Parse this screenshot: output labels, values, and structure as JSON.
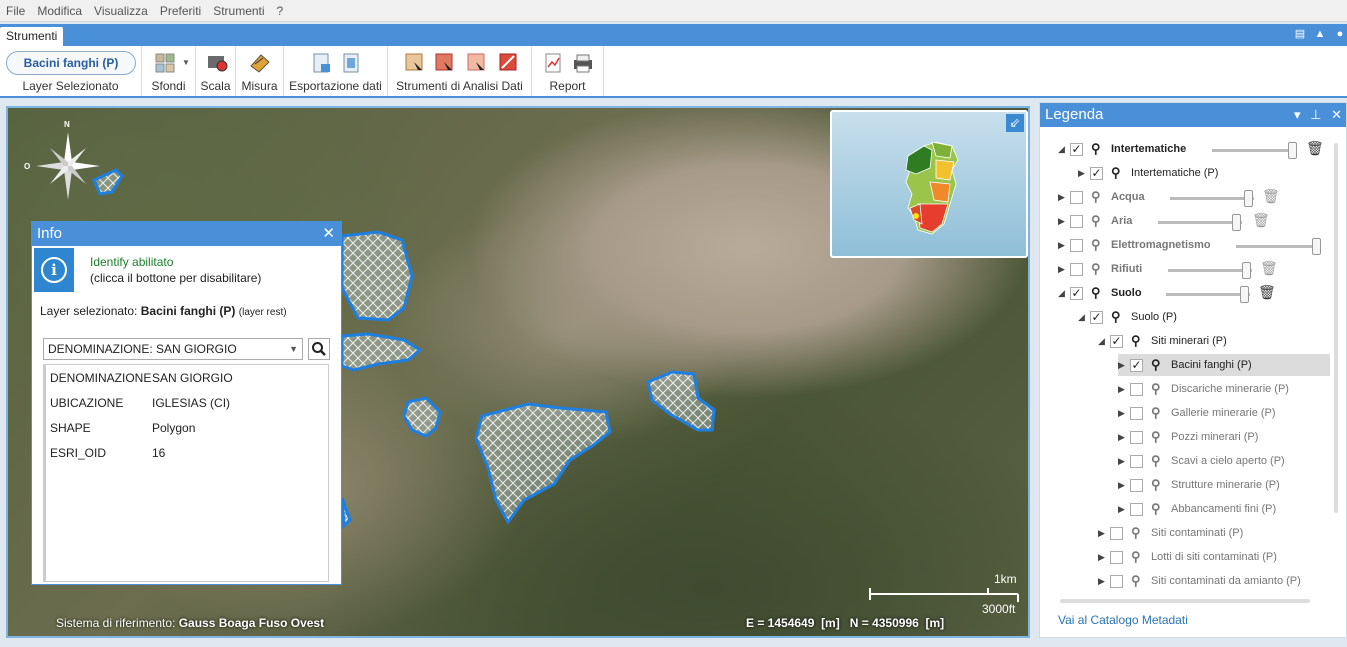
{
  "menu": [
    "File",
    "Modifica",
    "Visualizza",
    "Preferiti",
    "Strumenti",
    "?"
  ],
  "ribbon": {
    "tab": "Strumenti",
    "layer_button": "Bacini fanghi (P)",
    "groups": {
      "layer": "Layer Selezionato",
      "sfondi": "Sfondi",
      "scala": "Scala",
      "misura": "Misura",
      "esportazione": "Esportazione dati",
      "analisi": "Strumenti di Analisi Dati",
      "report": "Report"
    }
  },
  "map": {
    "compass": {
      "n": "N",
      "o": "O"
    },
    "scale_km": "1km",
    "scale_ft": "3000ft",
    "ref_label": "Sistema di riferimento:",
    "ref_value": "Gauss Boaga Fuso Ovest",
    "coords": "E = 1454649  [m]   N = 4350996  [m]"
  },
  "info": {
    "title": "Info",
    "status_title": "Identify abilitato",
    "status_sub": "(clicca il bottone per disabilitare)",
    "layer_label": "Layer selezionato:",
    "layer_name": "Bacini fanghi (P)",
    "layer_type": "(layer rest)",
    "select_value": "DENOMINAZIONE: SAN GIORGIO",
    "attributes": [
      {
        "k": "DENOMINAZIONE",
        "v": "SAN GIORGIO"
      },
      {
        "k": "UBICAZIONE",
        "v": "IGLESIAS (CI)"
      },
      {
        "k": "SHAPE",
        "v": "Polygon"
      },
      {
        "k": "ESRI_OID",
        "v": "16"
      }
    ]
  },
  "legend": {
    "title": "Legenda",
    "items": [
      {
        "label": "Intertematiche"
      },
      {
        "label": "Intertematiche (P)"
      },
      {
        "label": "Acqua"
      },
      {
        "label": "Aria"
      },
      {
        "label": "Elettromagnetismo"
      },
      {
        "label": "Rifiuti"
      },
      {
        "label": "Suolo"
      },
      {
        "label": "Suolo (P)"
      },
      {
        "label": "Siti minerari (P)"
      },
      {
        "label": "Bacini fanghi (P)"
      },
      {
        "label": "Discariche minerarie (P)"
      },
      {
        "label": "Gallerie minerarie (P)"
      },
      {
        "label": "Pozzi minerari (P)"
      },
      {
        "label": "Scavi a cielo aperto (P)"
      },
      {
        "label": "Strutture minerarie (P)"
      },
      {
        "label": "Abbancamenti fini (P)"
      },
      {
        "label": "Siti contaminati (P)"
      },
      {
        "label": "Lotti di siti  contaminati (P)"
      },
      {
        "label": "Siti contaminati da amianto (P)"
      }
    ],
    "link": "Vai al Catalogo Metadati"
  }
}
